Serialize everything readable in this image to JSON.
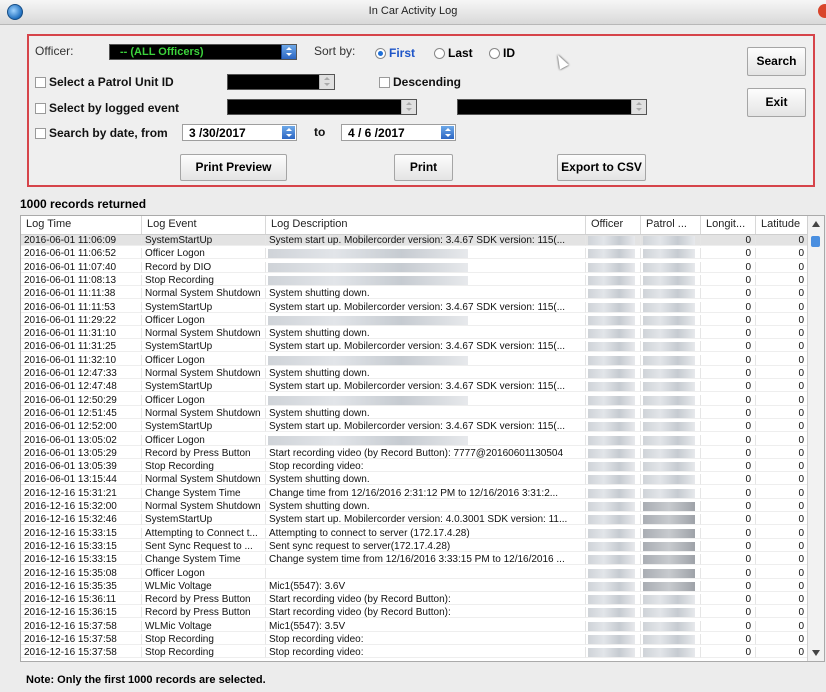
{
  "window": {
    "title": "In Car Activity Log"
  },
  "filters": {
    "officer_label": "Officer:",
    "officer_value": "-- (ALL Officers)",
    "sort_by_label": "Sort by:",
    "sort_first": "First",
    "sort_last": "Last",
    "sort_id": "ID",
    "patrol_unit_label": "Select a Patrol Unit ID",
    "descending_label": "Descending",
    "logged_event_label": "Select by logged event",
    "search_date_label": "Search by date, from",
    "date_from": "3 /30/2017",
    "to_label": "to",
    "date_to": "4 / 6 /2017"
  },
  "buttons": {
    "search": "Search",
    "exit": "Exit",
    "print_preview": "Print Preview",
    "print": "Print",
    "export_csv": "Export to CSV"
  },
  "records_returned": "1000 records returned",
  "columns": [
    "Log Time",
    "Log Event",
    "Log Description",
    "Officer",
    "Patrol ...",
    "Longit...",
    "Latitude"
  ],
  "rows": [
    [
      "2016-06-01 11:06:09",
      "SystemStartUp",
      "System start up. Mobilercorder version: 3.4.67 SDK version: 115(...",
      "0",
      "0"
    ],
    [
      "2016-06-01 11:06:52",
      "Officer Logon",
      "",
      "0",
      "0"
    ],
    [
      "2016-06-01 11:07:40",
      "Record by DIO",
      "",
      "0",
      "0"
    ],
    [
      "2016-06-01 11:08:13",
      "Stop Recording",
      "",
      "0",
      "0"
    ],
    [
      "2016-06-01 11:11:38",
      "Normal System Shutdown",
      "System shutting down.",
      "0",
      "0"
    ],
    [
      "2016-06-01 11:11:53",
      "SystemStartUp",
      "System start up. Mobilercorder version: 3.4.67 SDK version: 115(...",
      "0",
      "0"
    ],
    [
      "2016-06-01 11:29:22",
      "Officer Logon",
      "",
      "0",
      "0"
    ],
    [
      "2016-06-01 11:31:10",
      "Normal System Shutdown",
      "System shutting down.",
      "0",
      "0"
    ],
    [
      "2016-06-01 11:31:25",
      "SystemStartUp",
      "System start up. Mobilercorder version: 3.4.67 SDK version: 115(...",
      "0",
      "0"
    ],
    [
      "2016-06-01 11:32:10",
      "Officer Logon",
      "",
      "0",
      "0"
    ],
    [
      "2016-06-01 12:47:33",
      "Normal System Shutdown",
      "System shutting down.",
      "0",
      "0"
    ],
    [
      "2016-06-01 12:47:48",
      "SystemStartUp",
      "System start up. Mobilercorder version: 3.4.67 SDK version: 115(...",
      "0",
      "0"
    ],
    [
      "2016-06-01 12:50:29",
      "Officer Logon",
      "",
      "0",
      "0"
    ],
    [
      "2016-06-01 12:51:45",
      "Normal System Shutdown",
      "System shutting down.",
      "0",
      "0"
    ],
    [
      "2016-06-01 12:52:00",
      "SystemStartUp",
      "System start up. Mobilercorder version: 3.4.67 SDK version: 115(...",
      "0",
      "0"
    ],
    [
      "2016-06-01 13:05:02",
      "Officer Logon",
      "",
      "0",
      "0"
    ],
    [
      "2016-06-01 13:05:29",
      "Record by Press Button",
      "Start recording video (by Record Button): 7777@20160601130504",
      "0",
      "0"
    ],
    [
      "2016-06-01 13:05:39",
      "Stop Recording",
      "Stop recording video:",
      "0",
      "0"
    ],
    [
      "2016-06-01 13:15:44",
      "Normal System Shutdown",
      "System shutting down.",
      "0",
      "0"
    ],
    [
      "2016-12-16 15:31:21",
      "Change System Time",
      "Change time from  12/16/2016 2:31:12 PM to 12/16/2016 3:31:2...",
      "0",
      "0"
    ],
    [
      "2016-12-16 15:32:00",
      "Normal System Shutdown",
      "System shutting down.",
      "0",
      "0"
    ],
    [
      "2016-12-16 15:32:46",
      "SystemStartUp",
      "System start up. Mobilercorder version: 4.0.3001 SDK version:  11...",
      "0",
      "0"
    ],
    [
      "2016-12-16 15:33:15",
      "Attempting to Connect t...",
      "Attempting to connect to server (172.17.4.28)",
      "0",
      "0"
    ],
    [
      "2016-12-16 15:33:15",
      "Sent Sync Request to ...",
      "Sent sync request to server(172.17.4.28)",
      "0",
      "0"
    ],
    [
      "2016-12-16 15:33:15",
      "Change System Time",
      "Change system time from 12/16/2016 3:33:15 PM to 12/16/2016 ...",
      "0",
      "0"
    ],
    [
      "2016-12-16 15:35:08",
      "Officer Logon",
      "",
      "0",
      "0"
    ],
    [
      "2016-12-16 15:35:35",
      "WLMic Voltage",
      "Mic1(5547): 3.6V",
      "0",
      "0"
    ],
    [
      "2016-12-16 15:36:11",
      "Record by Press Button",
      "Start recording video (by Record Button):",
      "0",
      "0"
    ],
    [
      "2016-12-16 15:36:15",
      "Record by Press Button",
      "Start recording video (by Record Button):",
      "0",
      "0"
    ],
    [
      "2016-12-16 15:37:58",
      "WLMic Voltage",
      "Mic1(5547): 3.5V",
      "0",
      "0"
    ],
    [
      "2016-12-16 15:37:58",
      "Stop Recording",
      "Stop recording video:",
      "0",
      "0"
    ],
    [
      "2016-12-16 15:37:58",
      "Stop Recording",
      "Stop recording video:",
      "0",
      "0"
    ]
  ],
  "note": "Note: Only the first 1000 records are selected."
}
